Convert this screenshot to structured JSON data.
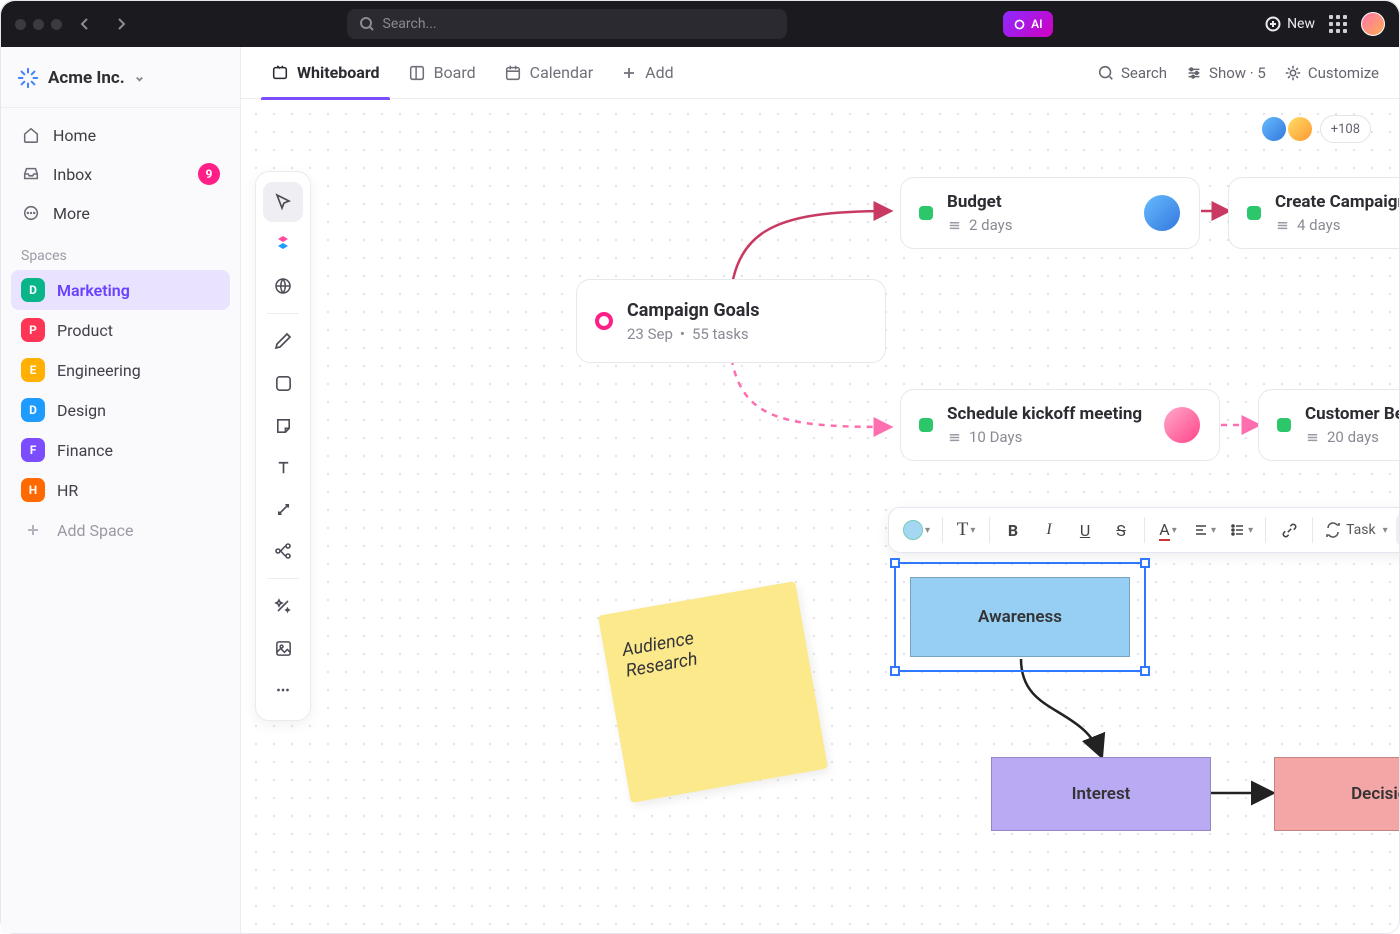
{
  "titlebar": {
    "search_placeholder": "Search...",
    "ai_label": "AI",
    "new_label": "New"
  },
  "workspace": {
    "name": "Acme Inc."
  },
  "sidebar": {
    "nav": {
      "home": "Home",
      "inbox": "Inbox",
      "inbox_badge": "9",
      "more": "More"
    },
    "spaces_label": "Spaces",
    "spaces": [
      {
        "letter": "D",
        "label": "Marketing",
        "cls": "d",
        "active": true
      },
      {
        "letter": "P",
        "label": "Product",
        "cls": "p"
      },
      {
        "letter": "E",
        "label": "Engineering",
        "cls": "e"
      },
      {
        "letter": "D",
        "label": "Design",
        "cls": "de"
      },
      {
        "letter": "F",
        "label": "Finance",
        "cls": "f"
      },
      {
        "letter": "H",
        "label": "HR",
        "cls": "h"
      }
    ],
    "add_space": "Add Space"
  },
  "tabs": {
    "whiteboard": "Whiteboard",
    "board": "Board",
    "calendar": "Calendar",
    "add": "Add",
    "search": "Search",
    "show": "Show · 5",
    "customize": "Customize"
  },
  "collab": {
    "more": "+108"
  },
  "cards": {
    "goal": {
      "title": "Campaign Goals",
      "date": "23 Sep",
      "tasks": "55 tasks"
    },
    "budget": {
      "title": "Budget",
      "meta": "2 days"
    },
    "create": {
      "title": "Create Campaign",
      "meta": "4 days"
    },
    "kickoff": {
      "title": "Schedule kickoff meeting",
      "meta": "10 Days"
    },
    "beta": {
      "title": "Customer Beta",
      "meta": "20 days"
    }
  },
  "sticky": {
    "line1": "Audience",
    "line2": "Research"
  },
  "shapes": {
    "awareness": "Awareness",
    "interest": "Interest",
    "decision": "Decision"
  },
  "fmt": {
    "task": "Task"
  }
}
